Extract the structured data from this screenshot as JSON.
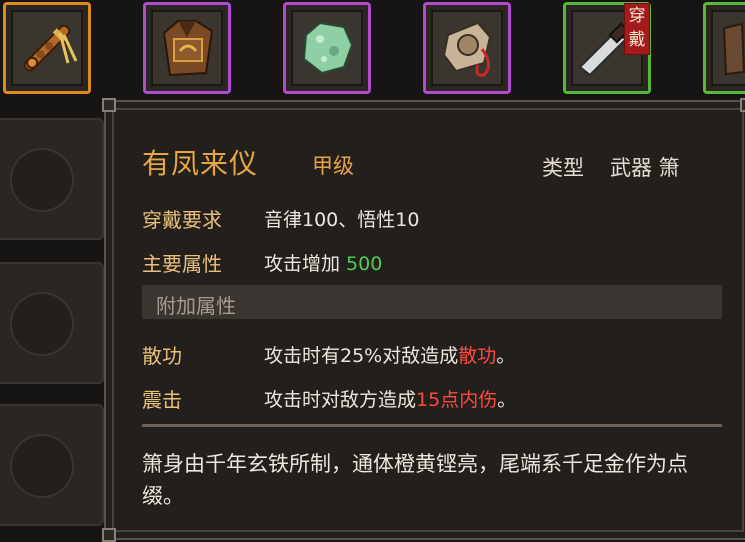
{
  "inventory": {
    "slots": [
      {
        "icon": "xiao-flute-icon",
        "rarity_color": "#e08a1e"
      },
      {
        "icon": "armor-vest-icon",
        "rarity_color": "#b04bd0"
      },
      {
        "icon": "jade-stone-icon",
        "rarity_color": "#b04bd0"
      },
      {
        "icon": "pouch-icon",
        "rarity_color": "#b04bd0"
      },
      {
        "icon": "machete-icon",
        "rarity_color": "#58b838",
        "badge": "穿戴"
      },
      {
        "icon": "partial-item-icon",
        "rarity_color": "#58b838"
      }
    ]
  },
  "tooltip": {
    "name": "有凤来仪",
    "grade": "甲级",
    "type_label": "类型",
    "type_value": "武器 箫",
    "requirement": {
      "label": "穿戴要求",
      "value": "音律100、悟性10"
    },
    "main_attr": {
      "label": "主要属性",
      "value_prefix": "攻击增加 ",
      "value_number": "500"
    },
    "extra_section_title": "附加属性",
    "extra_attrs": [
      {
        "label": "散功",
        "text_prefix": "攻击时有25%对敌造成",
        "highlight": "散功",
        "text_suffix": "。"
      },
      {
        "label": "震击",
        "text_prefix": "攻击时对敌方造成",
        "highlight": "15点内伤",
        "text_suffix": "。"
      }
    ],
    "description": "箫身由千年玄铁所制，通体橙黄铿亮，尾端系千足金作为点缀。"
  },
  "colors": {
    "title": "#e8a544",
    "label": "#e8c07a",
    "value_green": "#4fcf4f",
    "value_red": "#ff4a3d",
    "panel_bg": "#221f1c"
  }
}
